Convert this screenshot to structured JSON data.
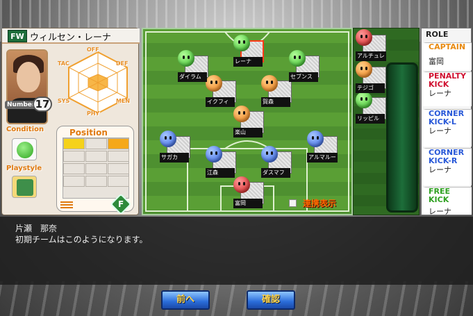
{
  "player_card": {
    "position": "FW",
    "name": "ウィルセン・レーナ",
    "number_label": "Number",
    "number": "17",
    "stats": {
      "off": "OFF",
      "def": "DEF",
      "men": "MEN",
      "phy": "PHY",
      "sys": "SYS",
      "tac": "TAC"
    },
    "condition_label": "Condition",
    "playstyle_label": "Playstyle",
    "position_label": "Position",
    "badge": "F"
  },
  "formation": [
    {
      "name": "レーナ",
      "color": "green",
      "selected": true
    },
    {
      "name": "ダイラム",
      "color": "green"
    },
    {
      "name": "セブンス",
      "color": "green"
    },
    {
      "name": "イクフィ",
      "color": "orange"
    },
    {
      "name": "賀森",
      "color": "orange"
    },
    {
      "name": "楽山",
      "color": "orange"
    },
    {
      "name": "サガカ",
      "color": "blue"
    },
    {
      "name": "アルマルー",
      "color": "blue"
    },
    {
      "name": "江森",
      "color": "blue"
    },
    {
      "name": "ダスマフ",
      "color": "blue"
    },
    {
      "name": "富岡",
      "color": "red"
    }
  ],
  "bench": [
    {
      "name": "アルチュレ",
      "color": "red"
    },
    {
      "name": "テジゴ",
      "color": "orange"
    },
    {
      "name": "リッピル",
      "color": "green"
    }
  ],
  "link_display_label": "連携表示",
  "roles": {
    "title": "ROLE",
    "items": [
      {
        "label": "CAPTAIN",
        "value": "富岡",
        "color": "#e88a10"
      },
      {
        "label": "PENALTY KICK",
        "value": "レーナ",
        "color": "#d01030"
      },
      {
        "label": "CORNER KICK-L",
        "value": "レーナ",
        "color": "#2858d8"
      },
      {
        "label": "CORNER KICK-R",
        "value": "レーナ",
        "color": "#2858d8"
      },
      {
        "label": "FREE KICK",
        "value": "レーナ",
        "color": "#2ea020"
      }
    ]
  },
  "message": {
    "speaker": "片瀬　那奈",
    "text": "初期チームはこのようになります。"
  },
  "buttons": {
    "back": "前へ",
    "confirm": "確認"
  }
}
